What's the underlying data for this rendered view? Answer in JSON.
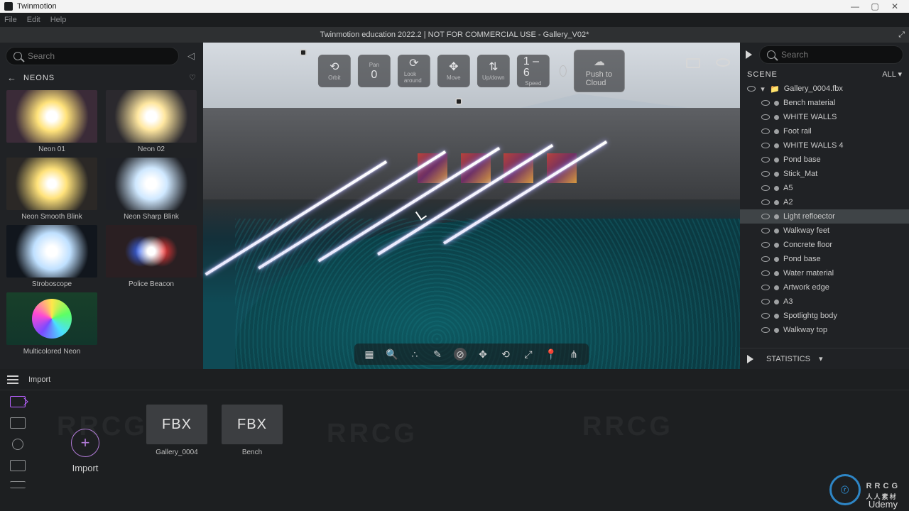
{
  "window": {
    "app": "Twinmotion"
  },
  "window_buttons": {
    "min": "—",
    "max": "▢",
    "close": "✕"
  },
  "menubar": {
    "file": "File",
    "edit": "Edit",
    "help": "Help"
  },
  "document_title": "Twinmotion education 2022.2 | NOT FOR COMMERCIAL USE - Gallery_V02*",
  "library": {
    "search_placeholder": "Search",
    "category": "NEONS",
    "items": [
      {
        "label": "Neon 01"
      },
      {
        "label": "Neon 02"
      },
      {
        "label": "Neon Smooth Blink"
      },
      {
        "label": "Neon Sharp Blink"
      },
      {
        "label": "Stroboscope"
      },
      {
        "label": "Police Beacon"
      },
      {
        "label": "Multicolored Neon"
      }
    ]
  },
  "nav": {
    "orbit": "Orbit",
    "pan_label": "Pan",
    "pan_key": "0",
    "look": "Look around",
    "move": "Move",
    "updown": "Up/down",
    "speed_label": "Speed",
    "speed_value": "1 – 6",
    "push": "Push to Cloud"
  },
  "scene": {
    "search_placeholder": "Search",
    "header": "SCENE",
    "filter": "ALL",
    "root": "Gallery_0004.fbx",
    "items": [
      "Bench material",
      "WHITE WALLS",
      "Foot rail",
      "WHITE WALLS 4",
      "Pond base",
      "Stick_Mat",
      "A5",
      "A2",
      "Light refloector",
      "Walkway feet",
      "Concrete floor",
      "Pond base",
      "Water material",
      "Artwork edge",
      "A3",
      "Spotlightg body",
      "Walkway top"
    ],
    "selected_index": 8,
    "stats": "STATISTICS"
  },
  "viewport_tools": [
    "grid",
    "zoom-region",
    "scatter",
    "eyedropper",
    "erase",
    "move",
    "rotate",
    "scale",
    "snap",
    "pivot"
  ],
  "dock": {
    "tab": "Import",
    "import_label": "Import",
    "files": [
      {
        "type": "FBX",
        "name": "Gallery_0004"
      },
      {
        "type": "FBX",
        "name": "Bench"
      }
    ]
  },
  "watermark": {
    "brand": "RRCG",
    "sub": "人人素材",
    "platform": "Udemy"
  }
}
